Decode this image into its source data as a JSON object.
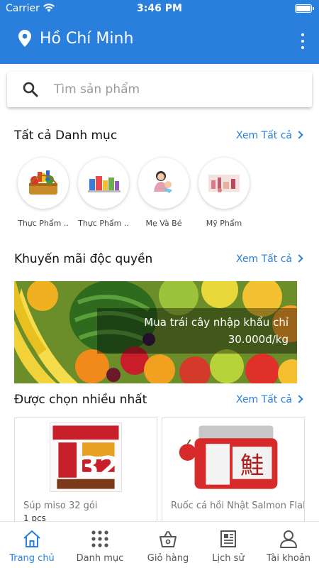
{
  "status_bar": {
    "carrier": "Carrier",
    "time": "3:46 PM"
  },
  "header": {
    "location": "Hồ Chí Minh"
  },
  "search": {
    "placeholder": "Tìm sản phẩm"
  },
  "categories_section": {
    "title": "Tất cả Danh mục",
    "see_all": "Xem Tất cả",
    "items": [
      {
        "label": "Thực Phẩm .."
      },
      {
        "label": "Thực Phẩm .."
      },
      {
        "label": "Mẹ Và Bé"
      },
      {
        "label": "Mỹ Phẩm"
      }
    ]
  },
  "promo_section": {
    "title": "Khuyến mãi độc quyền",
    "see_all": "Xem Tất cả",
    "banner_line1": "Mua trái cây nhập khẩu chỉ",
    "banner_line2": "30.000đ/kg"
  },
  "popular_section": {
    "title": "Được chọn nhiều nhất",
    "see_all": "Xem Tất cả",
    "products": [
      {
        "name": "Súp miso 32 gói",
        "unit": "1 pcs",
        "package_number": "32"
      },
      {
        "name": "Ruốc cá hồi Nhật Salmon Flake",
        "unit": "",
        "label_text": "鮭"
      }
    ]
  },
  "tab_bar": {
    "active": "home",
    "tabs": [
      {
        "key": "home",
        "label": "Trang chủ"
      },
      {
        "key": "category",
        "label": "Danh mục"
      },
      {
        "key": "cart",
        "label": "Giỏ hàng"
      },
      {
        "key": "history",
        "label": "Lịch sử"
      },
      {
        "key": "account",
        "label": "Tài khoản"
      }
    ]
  },
  "colors": {
    "primary": "#2a7fdc",
    "text": "#111111",
    "muted": "#777777"
  }
}
